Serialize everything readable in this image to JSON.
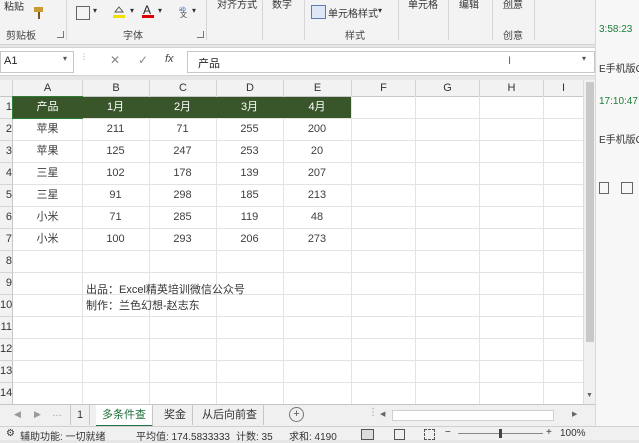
{
  "ribbon": {
    "paste_label": "粘贴",
    "clipboard_group": "剪贴板",
    "font_group": "字体",
    "alignment_label": "对齐方式",
    "number_label": "数字",
    "conditional_format_label": "单元格样式",
    "styles_group": "样式",
    "cells_label": "单元格",
    "editing_label": "编辑",
    "creative_label": "创意",
    "creative_group": "创意"
  },
  "formula_bar": {
    "name_box": "A1",
    "fx_label": "fx",
    "content": "产品"
  },
  "columns": [
    "A",
    "B",
    "C",
    "D",
    "E",
    "F",
    "G",
    "H",
    "I"
  ],
  "rows": [
    "1",
    "2",
    "3",
    "4",
    "5",
    "6",
    "7",
    "8",
    "9",
    "10",
    "11",
    "12",
    "13",
    "14",
    "15",
    "16"
  ],
  "table": {
    "headers": [
      "产品",
      "1月",
      "2月",
      "3月",
      "4月"
    ],
    "rows": [
      [
        "苹果",
        "211",
        "71",
        "255",
        "200"
      ],
      [
        "苹果",
        "125",
        "247",
        "253",
        "20"
      ],
      [
        "三星",
        "102",
        "178",
        "139",
        "207"
      ],
      [
        "三星",
        "91",
        "298",
        "185",
        "213"
      ],
      [
        "小米",
        "71",
        "285",
        "119",
        "48"
      ],
      [
        "小米",
        "100",
        "293",
        "206",
        "273"
      ]
    ]
  },
  "notes": {
    "line1": "出品：Excel精英培训微信公众号",
    "line2": "制作：兰色幻想-赵志东"
  },
  "sheet_tabs": [
    "1",
    "多条件查",
    "奖金",
    "从后向前查"
  ],
  "status": {
    "ready": "辅助功能: 一切就绪",
    "average": "平均值: 174.5833333",
    "count": "计数: 35",
    "sum": "求和: 4190",
    "zoom": "100%"
  },
  "right_panel": {
    "time1": "3:58:23",
    "text1": "E手机版Q",
    "time2": "17:10:47",
    "text2": "E手机版Q"
  },
  "colors": {
    "header_fill": "#38562a",
    "active_tab": "#217346",
    "time_color": "#1a7f37"
  }
}
